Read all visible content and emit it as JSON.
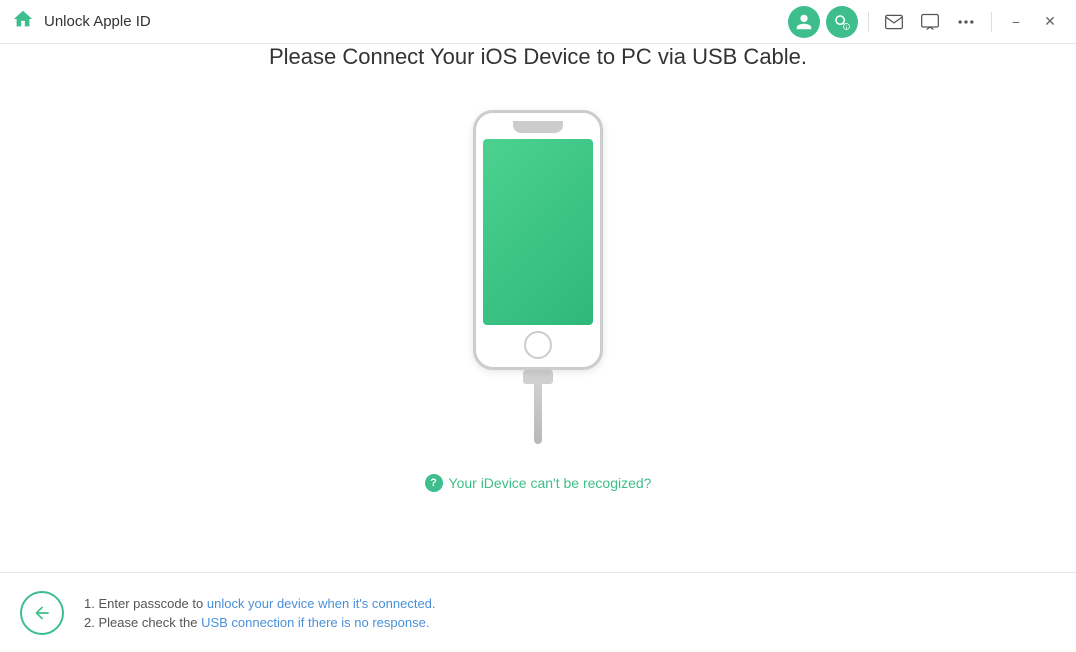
{
  "titlebar": {
    "title": "Unlock Apple ID",
    "home_icon_color": "#3dbe8c"
  },
  "main": {
    "heading": "Please Connect Your iOS Device to PC via USB Cable.",
    "help_link": "Your iDevice can't be recogized?"
  },
  "footer": {
    "tip1_prefix": "1. Enter passcode to ",
    "tip1_link": "unlock your device when it's connected.",
    "tip2_prefix": "2. Please check the ",
    "tip2_link": "USB connection if there is no response."
  }
}
